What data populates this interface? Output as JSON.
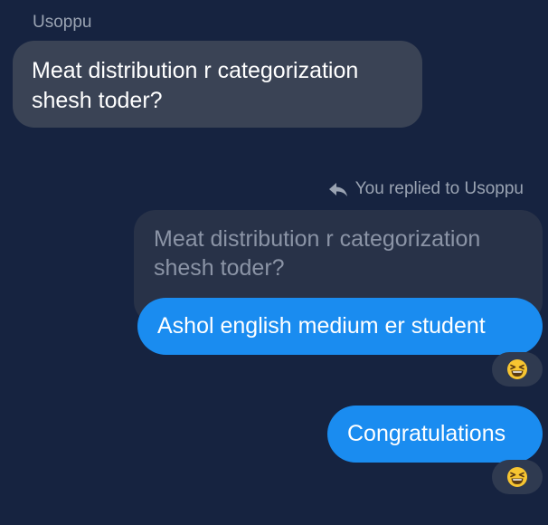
{
  "incoming": {
    "sender": "Usoppu",
    "message": "Meat distribution r categorization shesh toder?"
  },
  "reply_context": {
    "label": "You replied to Usoppu",
    "quoted_text": "Meat distribution r categorization shesh toder?",
    "icon": "reply-arrow-icon"
  },
  "outgoing": [
    {
      "text": "Ashol english medium er student",
      "reaction": "😆",
      "reaction_icon": "grinning-squinting-face-icon"
    },
    {
      "text": "Congratulations",
      "reaction": "😆",
      "reaction_icon": "grinning-squinting-face-icon"
    }
  ],
  "colors": {
    "background": "#162340",
    "incoming_bubble": "#3a4355",
    "quoted_bubble": "#283248",
    "outgoing_bubble": "#1a8cf0",
    "secondary_text": "#9aa3b2"
  }
}
